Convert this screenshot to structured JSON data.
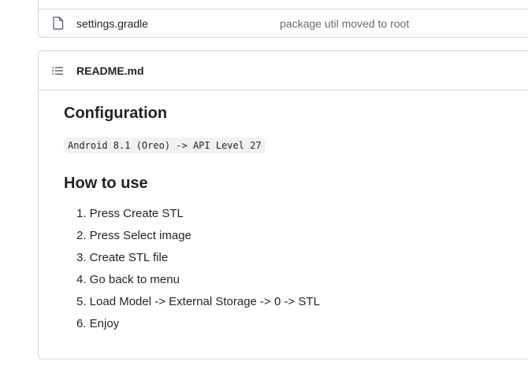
{
  "file_row": {
    "icon": "file-icon",
    "name": "settings.gradle",
    "commit_message": "package util moved to root"
  },
  "readme": {
    "icon": "list-unordered-icon",
    "title": "README.md",
    "config_heading": "Configuration",
    "config_code": "Android 8.1 (Oreo) -> API Level 27",
    "howto_heading": "How to use",
    "steps": [
      "1. Press Create STL",
      "2. Press Select image",
      "3. Create STL file",
      "4. Go back to menu",
      "5. Load Model -> External Storage -> 0 -> STL",
      "6. Enjoy"
    ]
  }
}
